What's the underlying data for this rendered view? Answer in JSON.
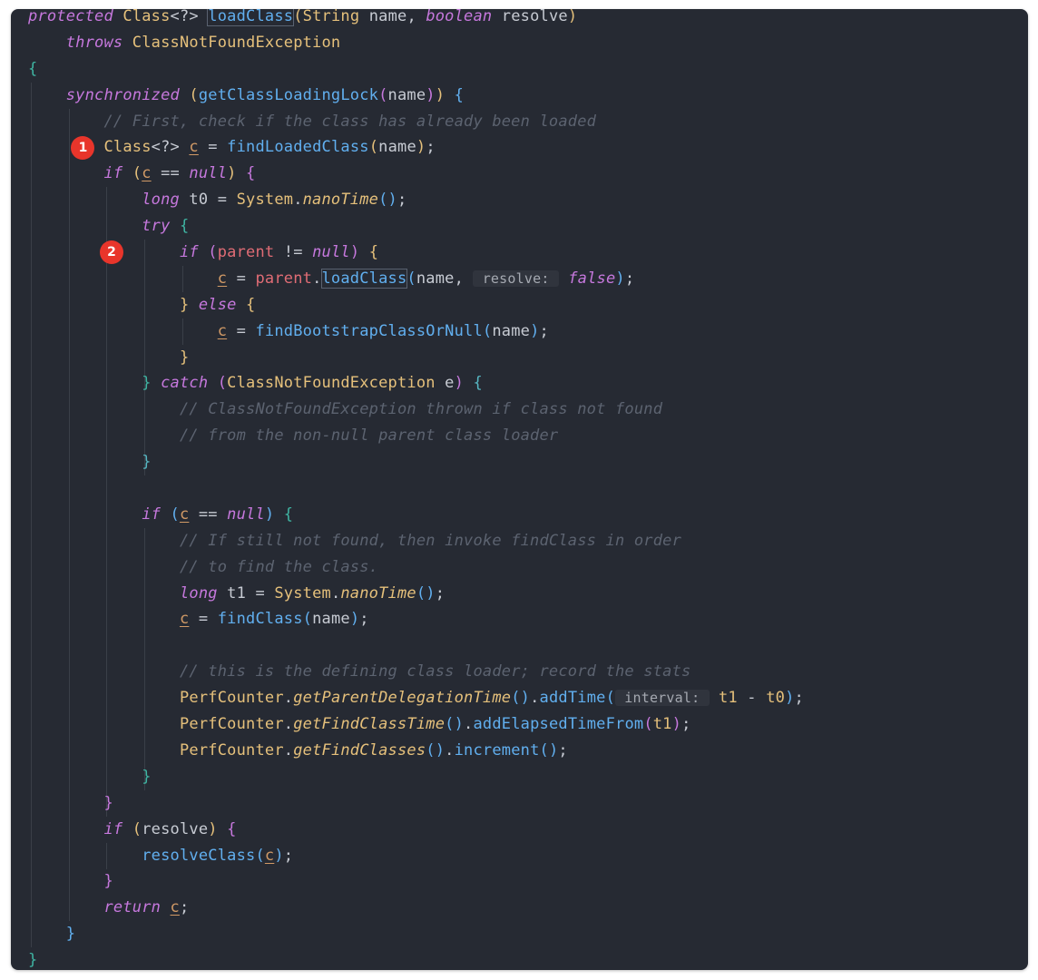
{
  "theme": {
    "background": "#262a33",
    "marker_color": "#e8352b"
  },
  "markers": [
    "1",
    "2"
  ],
  "code_lines": [
    [
      [
        "protected",
        "kw"
      ],
      [
        " ",
        "op"
      ],
      [
        "Class",
        "type"
      ],
      [
        "<?>",
        "op"
      ],
      [
        " ",
        "op"
      ],
      [
        "loadClass",
        "fn hl"
      ],
      [
        "(",
        "b1"
      ],
      [
        "String",
        "type"
      ],
      [
        " name, ",
        "ident"
      ],
      [
        "boolean",
        "kw"
      ],
      [
        " resolve",
        "ident"
      ],
      [
        ")",
        "b1"
      ]
    ],
    [
      [
        "    ",
        "op"
      ],
      [
        "throws",
        "kw"
      ],
      [
        " ",
        "op"
      ],
      [
        "ClassNotFoundException",
        "type"
      ]
    ],
    [
      [
        "{",
        "b4"
      ]
    ],
    [
      [
        "    ",
        "op"
      ],
      [
        "synchronized",
        "kw"
      ],
      [
        " ",
        "op"
      ],
      [
        "(",
        "b1"
      ],
      [
        "getClassLoadingLock",
        "fn"
      ],
      [
        "(",
        "b2"
      ],
      [
        "name",
        "ident"
      ],
      [
        ")",
        "b2"
      ],
      [
        ")",
        "b1"
      ],
      [
        " ",
        "op"
      ],
      [
        "{",
        "b3"
      ]
    ],
    [
      [
        "        ",
        "op"
      ],
      [
        "// First, check if the class has already been loaded",
        "cmt"
      ]
    ],
    [
      [
        "        ",
        "op"
      ],
      [
        "Class",
        "type"
      ],
      [
        "<?>",
        "op"
      ],
      [
        " ",
        "op"
      ],
      [
        "c",
        "var"
      ],
      [
        " = ",
        "op"
      ],
      [
        "findLoadedClass",
        "fn"
      ],
      [
        "(",
        "b1"
      ],
      [
        "name",
        "ident"
      ],
      [
        ")",
        "b1"
      ],
      [
        ";",
        "punc"
      ]
    ],
    [
      [
        "        ",
        "op"
      ],
      [
        "if",
        "kw"
      ],
      [
        " ",
        "op"
      ],
      [
        "(",
        "b1"
      ],
      [
        "c",
        "var"
      ],
      [
        " == ",
        "op"
      ],
      [
        "null",
        "kw"
      ],
      [
        ")",
        "b1"
      ],
      [
        " ",
        "op"
      ],
      [
        "{",
        "b2"
      ]
    ],
    [
      [
        "            ",
        "op"
      ],
      [
        "long",
        "kw"
      ],
      [
        " t0 = ",
        "ident"
      ],
      [
        "System",
        "type"
      ],
      [
        ".",
        "punc"
      ],
      [
        "nanoTime",
        "smeth"
      ],
      [
        "()",
        "b3"
      ],
      [
        ";",
        "punc"
      ]
    ],
    [
      [
        "            ",
        "op"
      ],
      [
        "try",
        "kw"
      ],
      [
        " ",
        "op"
      ],
      [
        "{",
        "b4"
      ]
    ],
    [
      [
        "                ",
        "op"
      ],
      [
        "if",
        "kw"
      ],
      [
        " ",
        "op"
      ],
      [
        "(",
        "b2"
      ],
      [
        "parent",
        "field"
      ],
      [
        " != ",
        "op"
      ],
      [
        "null",
        "kw"
      ],
      [
        ")",
        "b2"
      ],
      [
        " ",
        "op"
      ],
      [
        "{",
        "b1"
      ]
    ],
    [
      [
        "                    ",
        "op"
      ],
      [
        "c",
        "var"
      ],
      [
        " = ",
        "op"
      ],
      [
        "parent",
        "field"
      ],
      [
        ".",
        "punc"
      ],
      [
        "loadClass",
        "fn hl"
      ],
      [
        "(",
        "b3"
      ],
      [
        "name, ",
        "ident"
      ],
      [
        " resolve: ",
        "hint"
      ],
      [
        " ",
        "op"
      ],
      [
        "false",
        "kw"
      ],
      [
        ")",
        "b3"
      ],
      [
        ";",
        "punc"
      ]
    ],
    [
      [
        "                ",
        "op"
      ],
      [
        "}",
        "b1"
      ],
      [
        " ",
        "op"
      ],
      [
        "else",
        "kw"
      ],
      [
        " ",
        "op"
      ],
      [
        "{",
        "b1"
      ]
    ],
    [
      [
        "                    ",
        "op"
      ],
      [
        "c",
        "var"
      ],
      [
        " = ",
        "op"
      ],
      [
        "findBootstrapClassOrNull",
        "fn"
      ],
      [
        "(",
        "b3"
      ],
      [
        "name",
        "ident"
      ],
      [
        ")",
        "b3"
      ],
      [
        ";",
        "punc"
      ]
    ],
    [
      [
        "                ",
        "op"
      ],
      [
        "}",
        "b1"
      ]
    ],
    [
      [
        "            ",
        "op"
      ],
      [
        "}",
        "b4"
      ],
      [
        " ",
        "op"
      ],
      [
        "catch",
        "kw"
      ],
      [
        " ",
        "op"
      ],
      [
        "(",
        "b2"
      ],
      [
        "ClassNotFoundException",
        "type"
      ],
      [
        " e",
        "ident"
      ],
      [
        ")",
        "b2"
      ],
      [
        " ",
        "op"
      ],
      [
        "{",
        "b5"
      ]
    ],
    [
      [
        "                ",
        "op"
      ],
      [
        "// ClassNotFoundException thrown if class not found",
        "cmt"
      ]
    ],
    [
      [
        "                ",
        "op"
      ],
      [
        "// from the non-null parent class loader",
        "cmt"
      ]
    ],
    [
      [
        "            ",
        "op"
      ],
      [
        "}",
        "b5"
      ]
    ],
    [
      [
        "",
        "op"
      ]
    ],
    [
      [
        "            ",
        "op"
      ],
      [
        "if",
        "kw"
      ],
      [
        " ",
        "op"
      ],
      [
        "(",
        "b3"
      ],
      [
        "c",
        "var"
      ],
      [
        " == ",
        "op"
      ],
      [
        "null",
        "kw"
      ],
      [
        ")",
        "b3"
      ],
      [
        " ",
        "op"
      ],
      [
        "{",
        "b4"
      ]
    ],
    [
      [
        "                ",
        "op"
      ],
      [
        "// If still not found, then invoke findClass in order",
        "cmt"
      ]
    ],
    [
      [
        "                ",
        "op"
      ],
      [
        "// to find the class.",
        "cmt"
      ]
    ],
    [
      [
        "                ",
        "op"
      ],
      [
        "long",
        "kw"
      ],
      [
        " t1 = ",
        "ident"
      ],
      [
        "System",
        "type"
      ],
      [
        ".",
        "punc"
      ],
      [
        "nanoTime",
        "smeth"
      ],
      [
        "()",
        "b3"
      ],
      [
        ";",
        "punc"
      ]
    ],
    [
      [
        "                ",
        "op"
      ],
      [
        "c",
        "var"
      ],
      [
        " = ",
        "op"
      ],
      [
        "findClass",
        "fn"
      ],
      [
        "(",
        "b3"
      ],
      [
        "name",
        "ident"
      ],
      [
        ")",
        "b3"
      ],
      [
        ";",
        "punc"
      ]
    ],
    [
      [
        "",
        "op"
      ]
    ],
    [
      [
        "                ",
        "op"
      ],
      [
        "// this is the defining class loader; record the stats",
        "cmt"
      ]
    ],
    [
      [
        "                ",
        "op"
      ],
      [
        "PerfCounter",
        "type"
      ],
      [
        ".",
        "punc"
      ],
      [
        "getParentDelegationTime",
        "smeth"
      ],
      [
        "()",
        "b3"
      ],
      [
        ".",
        "punc"
      ],
      [
        "addTime",
        "fn"
      ],
      [
        "(",
        "b3"
      ],
      [
        " interval: ",
        "hint"
      ],
      [
        " ",
        "op"
      ],
      [
        "t1",
        "type"
      ],
      [
        " - ",
        "op"
      ],
      [
        "t0",
        "type"
      ],
      [
        ")",
        "b3"
      ],
      [
        ";",
        "punc"
      ]
    ],
    [
      [
        "                ",
        "op"
      ],
      [
        "PerfCounter",
        "type"
      ],
      [
        ".",
        "punc"
      ],
      [
        "getFindClassTime",
        "smeth"
      ],
      [
        "()",
        "b3"
      ],
      [
        ".",
        "punc"
      ],
      [
        "addElapsedTimeFrom",
        "fn"
      ],
      [
        "(",
        "b2"
      ],
      [
        "t1",
        "type"
      ],
      [
        ")",
        "b2"
      ],
      [
        ";",
        "punc"
      ]
    ],
    [
      [
        "                ",
        "op"
      ],
      [
        "PerfCounter",
        "type"
      ],
      [
        ".",
        "punc"
      ],
      [
        "getFindClasses",
        "smeth"
      ],
      [
        "()",
        "b3"
      ],
      [
        ".",
        "punc"
      ],
      [
        "increment",
        "fn"
      ],
      [
        "()",
        "b3"
      ],
      [
        ";",
        "punc"
      ]
    ],
    [
      [
        "            ",
        "op"
      ],
      [
        "}",
        "b4"
      ]
    ],
    [
      [
        "        ",
        "op"
      ],
      [
        "}",
        "b2"
      ]
    ],
    [
      [
        "        ",
        "op"
      ],
      [
        "if",
        "kw"
      ],
      [
        " ",
        "op"
      ],
      [
        "(",
        "b1"
      ],
      [
        "resolve",
        "ident"
      ],
      [
        ")",
        "b1"
      ],
      [
        " ",
        "op"
      ],
      [
        "{",
        "b2"
      ]
    ],
    [
      [
        "            ",
        "op"
      ],
      [
        "resolveClass",
        "fn"
      ],
      [
        "(",
        "b3"
      ],
      [
        "c",
        "var"
      ],
      [
        ")",
        "b3"
      ],
      [
        ";",
        "punc"
      ]
    ],
    [
      [
        "        ",
        "op"
      ],
      [
        "}",
        "b2"
      ]
    ],
    [
      [
        "        ",
        "op"
      ],
      [
        "return",
        "kw"
      ],
      [
        " ",
        "op"
      ],
      [
        "c",
        "var"
      ],
      [
        ";",
        "punc"
      ]
    ],
    [
      [
        "    ",
        "op"
      ],
      [
        "}",
        "b3"
      ]
    ],
    [
      [
        "}",
        "b4"
      ]
    ]
  ]
}
